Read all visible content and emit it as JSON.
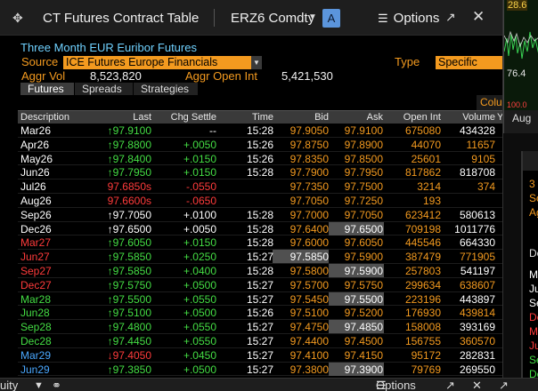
{
  "window": {
    "title": "CT Futures Contract Table",
    "ticker": "ERZ6 Comdty",
    "badge": "A",
    "options_label": "Options"
  },
  "header": {
    "heading": "Three Month EUR Euribor Futures",
    "source_label": "Source",
    "source_value": "ICE Futures Europe Financials",
    "type_label": "Type",
    "type_value": "Specific",
    "aggr_vol_label": "Aggr Vol",
    "aggr_vol_value": "8,523,820",
    "aggr_oi_label": "Aggr Open Int",
    "aggr_oi_value": "5,421,530"
  },
  "tabs": [
    "Futures",
    "Spreads",
    "Strategies"
  ],
  "columns_button": "Colu",
  "columns": [
    "Description",
    "Last",
    "Chg Settle",
    "Time",
    "Bid",
    "Ask",
    "Open Int",
    "Volume",
    "Ye"
  ],
  "rows": [
    {
      "desc": "Mar26",
      "desc_color": "#ffffff",
      "last": "↑97.9100",
      "last_color": "#44dd44",
      "chg": "--",
      "chg_color": "#ffffff",
      "time": "15:28",
      "bid": "97.9050",
      "ask": "97.9100",
      "oi": "675080",
      "vol": "434328",
      "vol_color": "#ffffff",
      "hl": ""
    },
    {
      "desc": "Apr26",
      "desc_color": "#ffffff",
      "last": "↑97.8800",
      "last_color": "#44dd44",
      "chg": "+.0050",
      "chg_color": "#44dd44",
      "time": "15:26",
      "bid": "97.8750",
      "ask": "97.8900",
      "oi": "44070",
      "vol": "11657",
      "vol_color": "#f39a1f",
      "hl": ""
    },
    {
      "desc": "May26",
      "desc_color": "#ffffff",
      "last": "↑97.8400",
      "last_color": "#44dd44",
      "chg": "+.0150",
      "chg_color": "#44dd44",
      "time": "15:26",
      "bid": "97.8350",
      "ask": "97.8500",
      "oi": "25601",
      "vol": "9105",
      "vol_color": "#f39a1f",
      "hl": ""
    },
    {
      "desc": "Jun26",
      "desc_color": "#ffffff",
      "last": "↑97.7950",
      "last_color": "#44dd44",
      "chg": "+.0150",
      "chg_color": "#44dd44",
      "time": "15:28",
      "bid": "97.7900",
      "ask": "97.7950",
      "oi": "817862",
      "vol": "818708",
      "vol_color": "#ffffff",
      "hl": ""
    },
    {
      "desc": "Jul26",
      "desc_color": "#ffffff",
      "last": "97.6850s",
      "last_color": "#ff3b3b",
      "chg": "-.0550",
      "chg_color": "#ff3b3b",
      "time": "",
      "bid": "97.7350",
      "ask": "97.7500",
      "oi": "3214",
      "vol": "374",
      "vol_color": "#f39a1f",
      "hl": ""
    },
    {
      "desc": "Aug26",
      "desc_color": "#ffffff",
      "last": "97.6600s",
      "last_color": "#ff3b3b",
      "chg": "-.0650",
      "chg_color": "#ff3b3b",
      "time": "",
      "bid": "97.7050",
      "ask": "97.7250",
      "oi": "193",
      "vol": "",
      "vol_color": "#f39a1f",
      "hl": ""
    },
    {
      "desc": "Sep26",
      "desc_color": "#ffffff",
      "last": "↑97.7050",
      "last_color": "#ffffff",
      "chg": "+.0100",
      "chg_color": "#ffffff",
      "time": "15:28",
      "bid": "97.7000",
      "ask": "97.7050",
      "oi": "623412",
      "vol": "580613",
      "vol_color": "#ffffff",
      "hl": ""
    },
    {
      "desc": "Dec26",
      "desc_color": "#ffffff",
      "last": "↑97.6500",
      "last_color": "#ffffff",
      "chg": "+.0050",
      "chg_color": "#ffffff",
      "time": "15:28",
      "bid": "97.6400",
      "ask": "97.6500",
      "oi": "709198",
      "vol": "1011776",
      "vol_color": "#ffffff",
      "hl": "ask"
    },
    {
      "desc": "Mar27",
      "desc_color": "#ff3b3b",
      "last": "↑97.6050",
      "last_color": "#44dd44",
      "chg": "+.0150",
      "chg_color": "#44dd44",
      "time": "15:28",
      "bid": "97.6000",
      "ask": "97.6050",
      "oi": "445546",
      "vol": "664330",
      "vol_color": "#ffffff",
      "hl": ""
    },
    {
      "desc": "Jun27",
      "desc_color": "#ff3b3b",
      "last": "↑97.5850",
      "last_color": "#44dd44",
      "chg": "+.0250",
      "chg_color": "#44dd44",
      "time": "15:27",
      "bid": "97.5850",
      "ask": "97.5900",
      "oi": "387479",
      "vol": "771905",
      "vol_color": "#f39a1f",
      "hl": "bid"
    },
    {
      "desc": "Sep27",
      "desc_color": "#ff3b3b",
      "last": "↑97.5850",
      "last_color": "#44dd44",
      "chg": "+.0400",
      "chg_color": "#44dd44",
      "time": "15:28",
      "bid": "97.5800",
      "ask": "97.5900",
      "oi": "257803",
      "vol": "541197",
      "vol_color": "#ffffff",
      "hl": "ask"
    },
    {
      "desc": "Dec27",
      "desc_color": "#ff3b3b",
      "last": "↑97.5750",
      "last_color": "#44dd44",
      "chg": "+.0500",
      "chg_color": "#44dd44",
      "time": "15:27",
      "bid": "97.5700",
      "ask": "97.5750",
      "oi": "299634",
      "vol": "638607",
      "vol_color": "#f39a1f",
      "hl": ""
    },
    {
      "desc": "Mar28",
      "desc_color": "#44dd44",
      "last": "↑97.5500",
      "last_color": "#44dd44",
      "chg": "+.0550",
      "chg_color": "#44dd44",
      "time": "15:27",
      "bid": "97.5450",
      "ask": "97.5500",
      "oi": "223196",
      "vol": "443897",
      "vol_color": "#ffffff",
      "hl": "ask"
    },
    {
      "desc": "Jun28",
      "desc_color": "#44dd44",
      "last": "↑97.5100",
      "last_color": "#44dd44",
      "chg": "+.0500",
      "chg_color": "#44dd44",
      "time": "15:26",
      "bid": "97.5100",
      "ask": "97.5200",
      "oi": "176930",
      "vol": "439814",
      "vol_color": "#f39a1f",
      "hl": ""
    },
    {
      "desc": "Sep28",
      "desc_color": "#44dd44",
      "last": "↑97.4800",
      "last_color": "#44dd44",
      "chg": "+.0550",
      "chg_color": "#44dd44",
      "time": "15:27",
      "bid": "97.4750",
      "ask": "97.4850",
      "oi": "158008",
      "vol": "393169",
      "vol_color": "#ffffff",
      "hl": "ask"
    },
    {
      "desc": "Dec28",
      "desc_color": "#44dd44",
      "last": "↑97.4450",
      "last_color": "#44dd44",
      "chg": "+.0550",
      "chg_color": "#44dd44",
      "time": "15:27",
      "bid": "97.4400",
      "ask": "97.4500",
      "oi": "156755",
      "vol": "360570",
      "vol_color": "#f39a1f",
      "hl": ""
    },
    {
      "desc": "Mar29",
      "desc_color": "#4aa8ff",
      "last": "↓97.4050",
      "last_color": "#ff3b3b",
      "chg": "+.0450",
      "chg_color": "#44dd44",
      "time": "15:27",
      "bid": "97.4100",
      "ask": "97.4150",
      "oi": "95172",
      "vol": "282831",
      "vol_color": "#ffffff",
      "hl": ""
    },
    {
      "desc": "Jun29",
      "desc_color": "#4aa8ff",
      "last": "↑97.3850",
      "last_color": "#44dd44",
      "chg": "+.0500",
      "chg_color": "#44dd44",
      "time": "15:27",
      "bid": "97.3800",
      "ask": "97.3900",
      "oi": "79769",
      "vol": "269550",
      "vol_color": "#ffffff",
      "hl": "ask"
    }
  ],
  "bg_chart": {
    "top_label": "28.6",
    "mid_label": "76.4",
    "red_label": "100.0",
    "axis_label": "Aug"
  },
  "bg_panel2": [
    "3",
    "So",
    "Ag",
    "De",
    "Ma",
    "Ju",
    "Se",
    "De",
    "Ma",
    "Ju",
    "Se",
    "De"
  ],
  "bottombar": {
    "left_text": "uity",
    "options_label": "Options"
  }
}
